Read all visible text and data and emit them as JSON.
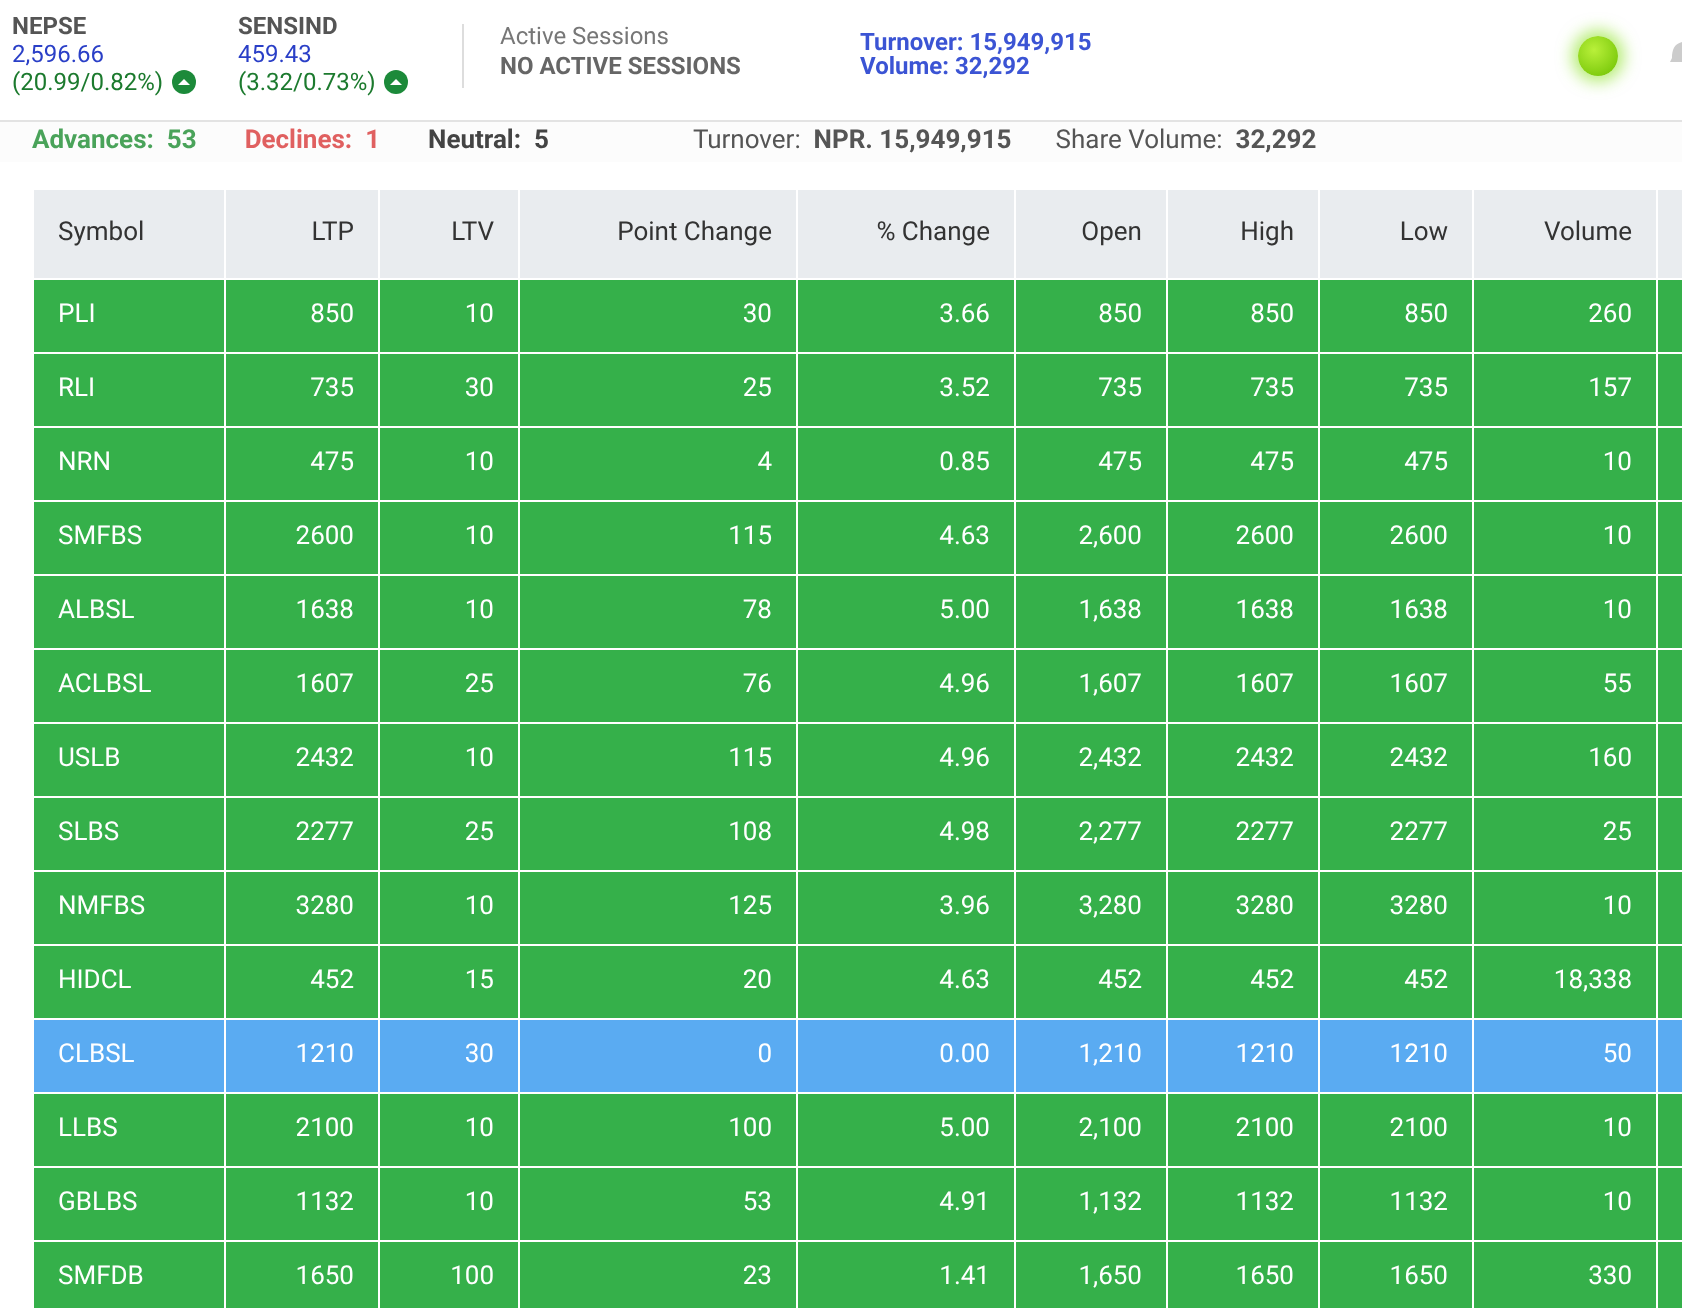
{
  "indices": [
    {
      "name": "NEPSE",
      "value": "2,596.66",
      "change": "(20.99/0.82%)",
      "up": true
    },
    {
      "name": "SENSIND",
      "value": "459.43",
      "change": "(3.32/0.73%)",
      "up": true
    }
  ],
  "sessions": {
    "label": "Active Sessions",
    "status": "NO ACTIVE SESSIONS"
  },
  "summary_top": {
    "turnover": "Turnover: 15,949,915",
    "volume": "Volume: 32,292"
  },
  "market_open": true,
  "stats": {
    "advances_label": "Advances:",
    "advances": "53",
    "declines_label": "Declines:",
    "declines": "1",
    "neutral_label": "Neutral:",
    "neutral": "5",
    "turnover_label": "Turnover:",
    "turnover": "NPR. 15,949,915",
    "volume_label": "Share Volume:",
    "volume": "32,292"
  },
  "table": {
    "columns": [
      "Symbol",
      "LTP",
      "LTV",
      "Point Change",
      "% Change",
      "Open",
      "High",
      "Low",
      "Volume"
    ],
    "rows": [
      {
        "kind": "up",
        "cells": [
          "PLI",
          "850",
          "10",
          "30",
          "3.66",
          "850",
          "850",
          "850",
          "260"
        ]
      },
      {
        "kind": "up",
        "cells": [
          "RLI",
          "735",
          "30",
          "25",
          "3.52",
          "735",
          "735",
          "735",
          "157"
        ]
      },
      {
        "kind": "up",
        "cells": [
          "NRN",
          "475",
          "10",
          "4",
          "0.85",
          "475",
          "475",
          "475",
          "10"
        ]
      },
      {
        "kind": "up",
        "cells": [
          "SMFBS",
          "2600",
          "10",
          "115",
          "4.63",
          "2,600",
          "2600",
          "2600",
          "10"
        ]
      },
      {
        "kind": "up",
        "cells": [
          "ALBSL",
          "1638",
          "10",
          "78",
          "5.00",
          "1,638",
          "1638",
          "1638",
          "10"
        ]
      },
      {
        "kind": "up",
        "cells": [
          "ACLBSL",
          "1607",
          "25",
          "76",
          "4.96",
          "1,607",
          "1607",
          "1607",
          "55"
        ]
      },
      {
        "kind": "up",
        "cells": [
          "USLB",
          "2432",
          "10",
          "115",
          "4.96",
          "2,432",
          "2432",
          "2432",
          "160"
        ]
      },
      {
        "kind": "up",
        "cells": [
          "SLBS",
          "2277",
          "25",
          "108",
          "4.98",
          "2,277",
          "2277",
          "2277",
          "25"
        ]
      },
      {
        "kind": "up",
        "cells": [
          "NMFBS",
          "3280",
          "10",
          "125",
          "3.96",
          "3,280",
          "3280",
          "3280",
          "10"
        ]
      },
      {
        "kind": "up",
        "cells": [
          "HIDCL",
          "452",
          "15",
          "20",
          "4.63",
          "452",
          "452",
          "452",
          "18,338"
        ]
      },
      {
        "kind": "neutral",
        "cells": [
          "CLBSL",
          "1210",
          "30",
          "0",
          "0.00",
          "1,210",
          "1210",
          "1210",
          "50"
        ]
      },
      {
        "kind": "up",
        "cells": [
          "LLBS",
          "2100",
          "10",
          "100",
          "5.00",
          "2,100",
          "2100",
          "2100",
          "10"
        ]
      },
      {
        "kind": "up",
        "cells": [
          "GBLBS",
          "1132",
          "10",
          "53",
          "4.91",
          "1,132",
          "1132",
          "1132",
          "10"
        ]
      },
      {
        "kind": "up",
        "cells": [
          "SMFDB",
          "1650",
          "100",
          "23",
          "1.41",
          "1,650",
          "1650",
          "1650",
          "330"
        ]
      }
    ]
  }
}
